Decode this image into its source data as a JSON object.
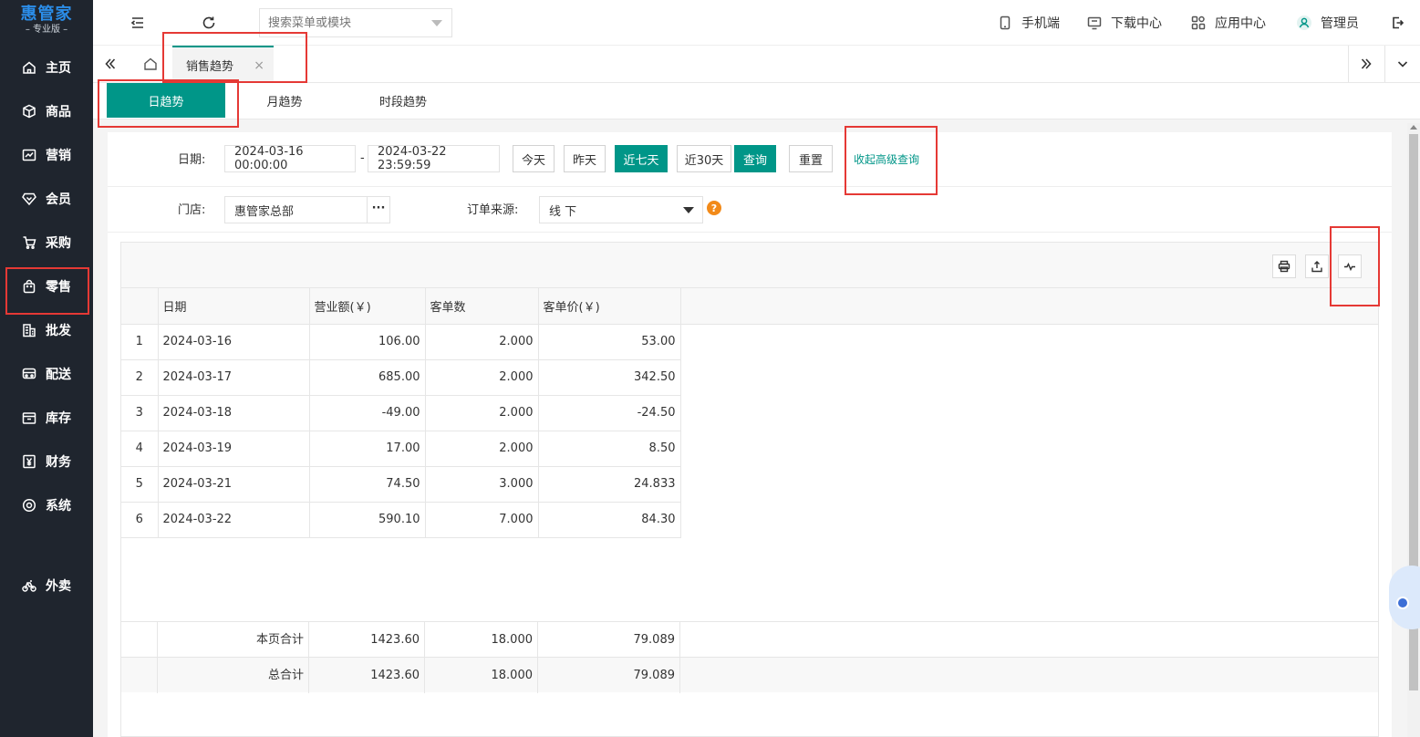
{
  "app": {
    "brand": "惠管家",
    "edition": "– 专业版 –"
  },
  "sidebar": {
    "items": [
      {
        "label": "主页",
        "icon": "home-icon"
      },
      {
        "label": "商品",
        "icon": "box-icon"
      },
      {
        "label": "营销",
        "icon": "chart-icon"
      },
      {
        "label": "会员",
        "icon": "diamond-icon"
      },
      {
        "label": "采购",
        "icon": "cart-icon"
      },
      {
        "label": "零售",
        "icon": "bag-icon"
      },
      {
        "label": "批发",
        "icon": "building-icon"
      },
      {
        "label": "配送",
        "icon": "truck-icon"
      },
      {
        "label": "库存",
        "icon": "inventory-icon"
      },
      {
        "label": "财务",
        "icon": "yen-icon"
      },
      {
        "label": "系统",
        "icon": "settings-icon"
      },
      {
        "label": "外卖",
        "icon": "bike-icon"
      }
    ]
  },
  "topbar": {
    "search_placeholder": "搜索菜单或模块",
    "mobile": "手机端",
    "download": "下载中心",
    "apps": "应用中心",
    "user": "管理员"
  },
  "tabs": {
    "active_tab": "销售趋势",
    "close": "×"
  },
  "subtabs": [
    "日趋势",
    "月趋势",
    "时段趋势"
  ],
  "filters": {
    "date_label": "日期:",
    "date_start": "2024-03-16 00:00:00",
    "date_sep": "-",
    "date_end": "2024-03-22 23:59:59",
    "btn_today": "今天",
    "btn_yesterday": "昨天",
    "btn_7days": "近七天",
    "btn_30days": "近30天",
    "btn_query": "查询",
    "btn_reset": "重置",
    "advanced_link": "收起高级查询",
    "store_label": "门店:",
    "store_value": "惠管家总部",
    "store_more": "···",
    "source_label": "订单来源:",
    "source_value": "线 下",
    "help": "?"
  },
  "table": {
    "headers": [
      "日期",
      "营业额(￥)",
      "客单数",
      "客单价(￥)"
    ],
    "rows": [
      {
        "idx": "1",
        "date": "2024-03-16",
        "revenue": "106.00",
        "orders": "2.000",
        "avg": "53.00"
      },
      {
        "idx": "2",
        "date": "2024-03-17",
        "revenue": "685.00",
        "orders": "2.000",
        "avg": "342.50"
      },
      {
        "idx": "3",
        "date": "2024-03-18",
        "revenue": "-49.00",
        "orders": "2.000",
        "avg": "-24.50"
      },
      {
        "idx": "4",
        "date": "2024-03-19",
        "revenue": "17.00",
        "orders": "2.000",
        "avg": "8.50"
      },
      {
        "idx": "5",
        "date": "2024-03-21",
        "revenue": "74.50",
        "orders": "3.000",
        "avg": "24.833"
      },
      {
        "idx": "6",
        "date": "2024-03-22",
        "revenue": "590.10",
        "orders": "7.000",
        "avg": "84.30"
      }
    ],
    "page_total": {
      "label": "本页合计",
      "revenue": "1423.60",
      "orders": "18.000",
      "avg": "79.089"
    },
    "grand_total": {
      "label": "总合计",
      "revenue": "1423.60",
      "orders": "18.000",
      "avg": "79.089"
    }
  },
  "colors": {
    "accent": "#009688",
    "sidebar_bg": "#1f252e",
    "highlight": "#e53935"
  }
}
